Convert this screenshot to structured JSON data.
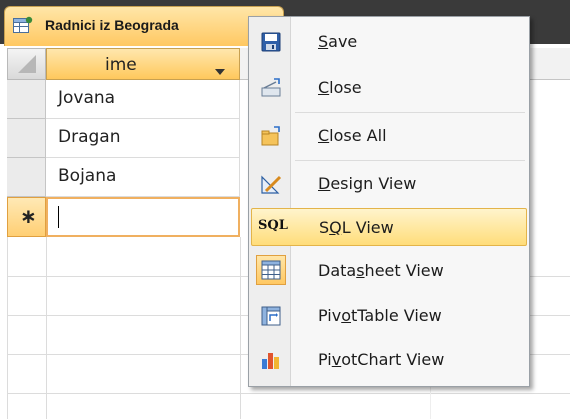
{
  "tab": {
    "title": "Radnici iz Beograda",
    "icon": "query-icon"
  },
  "datasheet": {
    "column_header": "ime",
    "rows": [
      "Jovana",
      "Dragan",
      "Bojana"
    ],
    "new_row_marker": "∗"
  },
  "context_menu": {
    "items": [
      {
        "pre": "",
        "u": "S",
        "post": "ave",
        "icon": "save-icon"
      },
      {
        "pre": "",
        "u": "C",
        "post": "lose",
        "icon": "close-icon"
      },
      {
        "pre": "",
        "u": "C",
        "post": "lose All",
        "icon": "close-all-icon"
      },
      {
        "pre": "",
        "u": "D",
        "post": "esign View",
        "icon": "design-view-icon"
      },
      {
        "pre": "S",
        "u": "Q",
        "post": "L View",
        "icon": "sql-view-icon",
        "icon_text": "SQL"
      },
      {
        "pre": "Data",
        "u": "s",
        "post": "heet View",
        "icon": "datasheet-view-icon"
      },
      {
        "pre": "Piv",
        "u": "o",
        "post": "tTable View",
        "icon": "pivottable-view-icon"
      },
      {
        "pre": "Pi",
        "u": "v",
        "post": "otChart View",
        "icon": "pivotchart-view-icon"
      }
    ]
  }
}
